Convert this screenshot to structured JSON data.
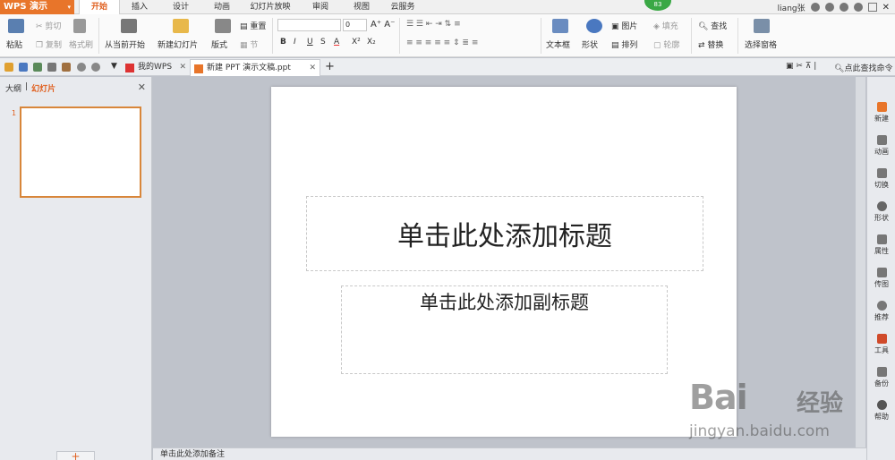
{
  "app": {
    "name": "WPS 演示",
    "menu_arrow": "▾"
  },
  "menu_tabs": [
    "开始",
    "插入",
    "设计",
    "动画",
    "幻灯片放映",
    "审阅",
    "视图",
    "云服务"
  ],
  "user": {
    "name": "liang张",
    "badge": "83"
  },
  "ribbon": {
    "paste": "粘贴",
    "cut": "剪切",
    "copy": "复制",
    "format_painter": "格式刷",
    "from_current": "从当前开始",
    "new_slide": "新建幻灯片",
    "layout": "版式",
    "reset": "重置",
    "section": "节",
    "font_size": "0",
    "bold": "B",
    "italic": "I",
    "underline": "U",
    "strike": "S",
    "font_color": "A",
    "superscript": "X²",
    "subscript": "X₂",
    "text_box": "文本框",
    "shape": "形状",
    "picture": "图片",
    "fill": "填充",
    "arrange": "排列",
    "outline": "轮廓",
    "find": "查找",
    "replace": "替换",
    "select_pane": "选择窗格"
  },
  "doc_tabs": [
    {
      "label": "我的WPS"
    },
    {
      "label": "新建 PPT 演示文稿.ppt"
    }
  ],
  "search_command": "点此查找命令",
  "left_pane": {
    "tab_outline": "大纲",
    "tab_slides": "幻灯片",
    "slide_number": "1",
    "add": "+"
  },
  "slide": {
    "title_placeholder": "单击此处添加标题",
    "subtitle_placeholder": "单击此处添加副标题"
  },
  "notes_placeholder": "单击此处添加备注",
  "right_panel": [
    "新建",
    "动画",
    "切换",
    "形状",
    "属性",
    "传图",
    "推荐",
    "工具",
    "备份",
    "帮助"
  ],
  "watermark": {
    "brand": "Bai",
    "cn": "经验",
    "url": "jingyan.baidu.com"
  },
  "colors": {
    "accent": "#e8752a",
    "selected_border": "#d8863a"
  }
}
